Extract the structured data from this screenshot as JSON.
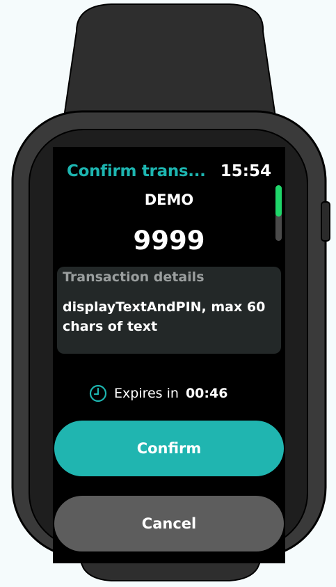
{
  "header": {
    "title": "Confirm trans...",
    "time": "15:54"
  },
  "service_name": "DEMO",
  "pin": "9999",
  "details": {
    "label": "Transaction details",
    "text": "displayTextAndPIN, max 60 chars of text"
  },
  "expiry": {
    "label": "Expires in",
    "time": "00:46",
    "icon": "clock-icon"
  },
  "buttons": {
    "confirm": "Confirm",
    "cancel": "Cancel"
  },
  "colors": {
    "accent": "#1db5b0",
    "confirm_button": "#20b5b0",
    "cancel_button": "#5d5d5d",
    "scroll_thumb": "#1fd66a",
    "details_background": "#232828"
  },
  "scroll": {
    "position_fraction": 0.0
  }
}
